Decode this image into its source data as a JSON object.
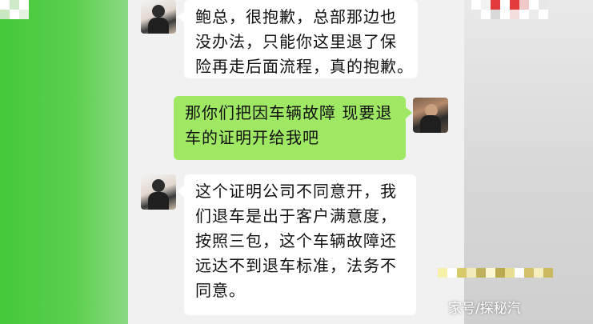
{
  "messages": [
    {
      "side": "left",
      "lines": [
        "鲍总，很抱歉，总部那边也",
        "没办法，只能你这里退了保",
        "险再走后面流程，真的抱歉。"
      ]
    },
    {
      "side": "right",
      "lines": [
        "那你们把因车辆故障 现要退",
        "车的证明开给我吧"
      ]
    },
    {
      "side": "left",
      "lines": [
        "这个证明公司不同意开，我",
        "们退车是出于客户满意度，",
        "按照三包，这个车辆故障还",
        "远达不到退车标准，法务不",
        "同意。"
      ]
    }
  ],
  "watermark": "家号/探秘汽",
  "colors": {
    "left_panel": "#4ccb3f",
    "bubble_green": "#9ee864",
    "bubble_white": "#ffffff"
  }
}
